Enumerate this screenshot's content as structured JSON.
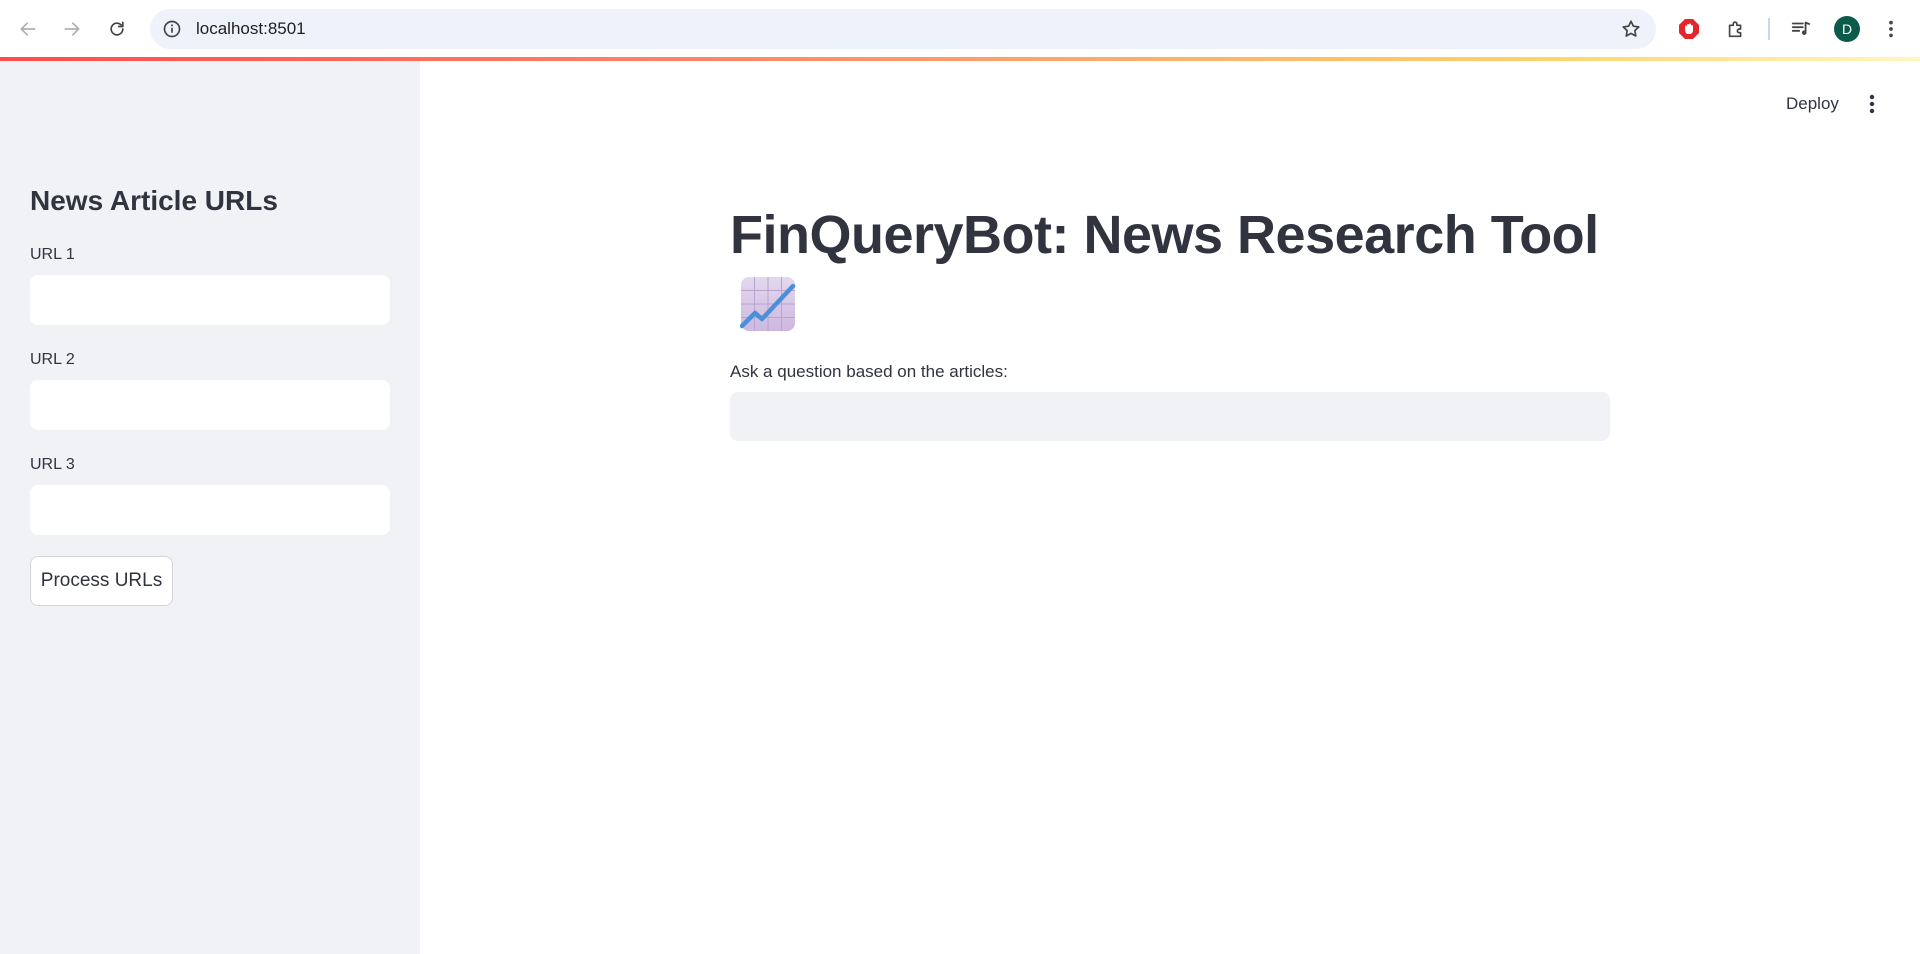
{
  "browser": {
    "url": "localhost:8501",
    "avatar_initial": "D"
  },
  "sidebar": {
    "title": "News Article URLs",
    "fields": [
      {
        "label": "URL 1",
        "value": ""
      },
      {
        "label": "URL 2",
        "value": ""
      },
      {
        "label": "URL 3",
        "value": ""
      }
    ],
    "button_label": "Process URLs"
  },
  "header": {
    "deploy_label": "Deploy"
  },
  "main": {
    "title": "FinQueryBot: News Research Tool",
    "title_emoji_icon": "chart-increasing-icon",
    "question_label": "Ask a question based on the articles:",
    "question_value": ""
  },
  "colors": {
    "accent": "#ff4b4b",
    "sidebar_bg": "#f0f2f6",
    "text": "#31333f",
    "avatar_bg": "#0b5a4a"
  }
}
